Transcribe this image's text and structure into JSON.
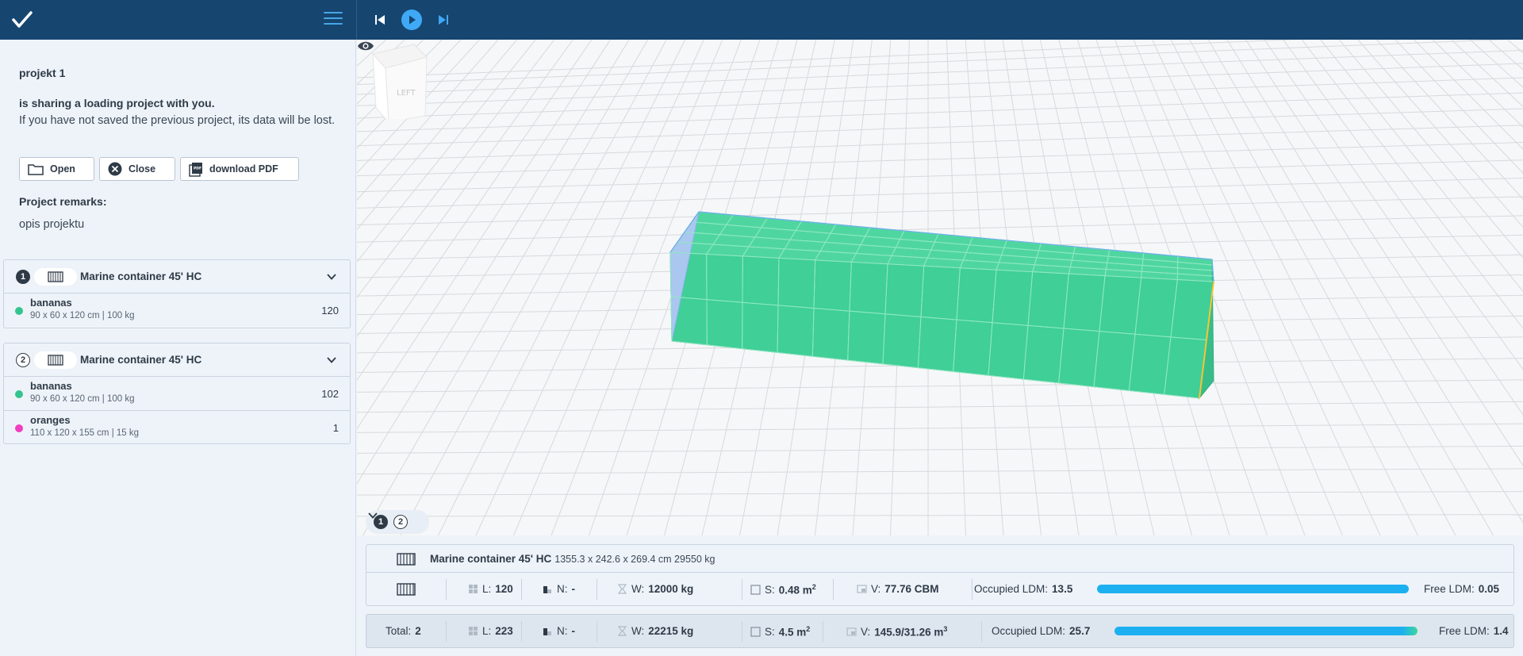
{
  "header": {
    "logo_icon": "check-logo-icon",
    "menu_icon": "hamburger-menu-icon",
    "controls": [
      "skip-previous-icon",
      "play-icon",
      "skip-next-icon"
    ]
  },
  "sidebar": {
    "project_name": "projekt 1",
    "share_title": "is sharing a loading project with you.",
    "share_text": "If you have not saved the previous project, its data will be lost.",
    "buttons": {
      "open": "Open",
      "close": "Close",
      "pdf": "download PDF"
    },
    "remarks_label": "Project remarks:",
    "remarks_text": "opis projektu",
    "containers": [
      {
        "number": "1",
        "title": "Marine container 45' HC",
        "cargo": [
          {
            "name": "bananas",
            "spec": "90 x 60 x 120 cm | 100 kg",
            "count": "120",
            "color": "#35c48f"
          }
        ]
      },
      {
        "number": "2",
        "title": "Marine container 45' HC",
        "cargo": [
          {
            "name": "bananas",
            "spec": "90 x 60 x 120 cm | 100 kg",
            "count": "102",
            "color": "#35c48f"
          },
          {
            "name": "oranges",
            "spec": "110 x 120 x 155 cm | 15 kg",
            "count": "1",
            "color": "#f03ec0"
          }
        ]
      }
    ]
  },
  "viewport": {
    "view_cube_label": "LEFT",
    "switcher": [
      "1",
      "2"
    ],
    "cargo_color": "#3fcf97"
  },
  "container_info": {
    "title": "Marine container 45' HC",
    "dims": "1355.3 x 242.6 x 269.4 cm 29550 kg",
    "stats": {
      "l_label": "L:",
      "l_value": "120",
      "n_label": "N:",
      "n_value": "-",
      "w_label": "W:",
      "w_value": "12000 kg",
      "s_label": "S:",
      "s_value": "0.48 m",
      "v_label": "V:",
      "v_value": "77.76 CBM",
      "occupied_label": "Occupied LDM:",
      "occupied_value": "13.5",
      "free_label": "Free LDM:",
      "free_value": "0.05"
    }
  },
  "totals": {
    "total_label": "Total:",
    "total_value": "2",
    "l_label": "L:",
    "l_value": "223",
    "n_label": "N:",
    "n_value": "-",
    "w_label": "W:",
    "w_value": "22215 kg",
    "s_label": "S:",
    "s_value": "4.5 m",
    "v_label": "V:",
    "v_value": "145.9/31.26 m",
    "occupied_label": "Occupied LDM:",
    "occupied_value": "25.7",
    "free_label": "Free LDM:",
    "free_value": "1.4"
  },
  "superscripts": {
    "two": "2",
    "three": "3"
  },
  "colors": {
    "header_bg": "#164570",
    "accent_blue": "#1db0f0",
    "play_blue": "#3fa9f5"
  }
}
